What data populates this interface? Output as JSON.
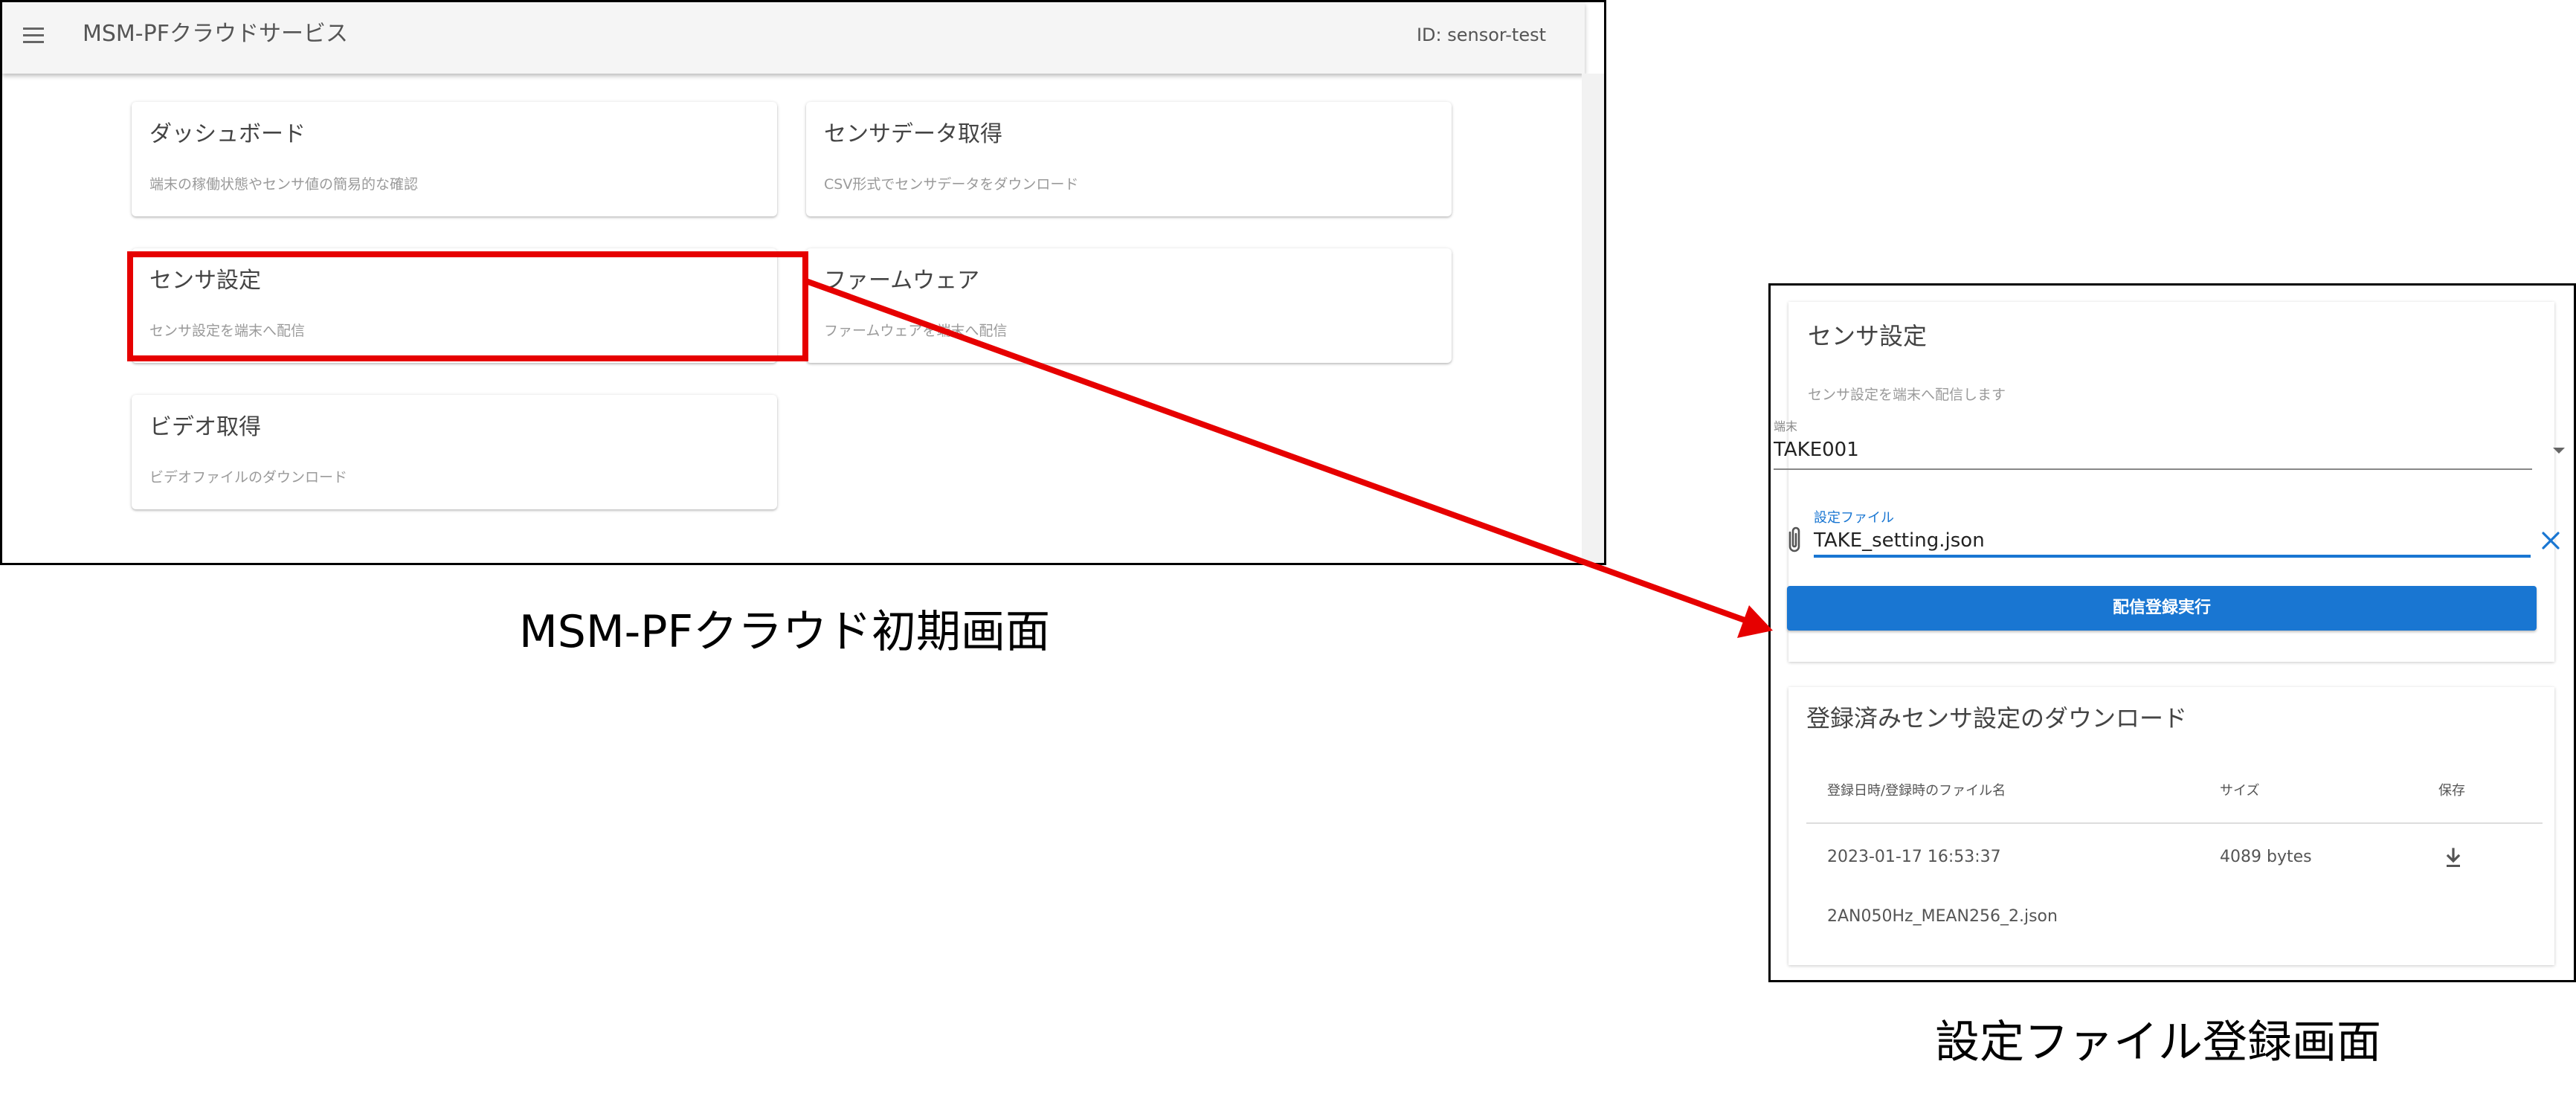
{
  "main_screen": {
    "app_title": "MSM-PFクラウドサービス",
    "user_id": "ID: sensor-test",
    "cards": [
      {
        "title": "ダッシュボード",
        "description": "端末の稼働状態やセンサ値の簡易的な確認"
      },
      {
        "title": "センサデータ取得",
        "description": "CSV形式でセンサデータをダウンロード"
      },
      {
        "title": "センサ設定",
        "description": "センサ設定を端末へ配信"
      },
      {
        "title": "ファームウェア",
        "description": "ファームウェアを端末へ配信"
      },
      {
        "title": "ビデオ取得",
        "description": "ビデオファイルのダウンロード"
      }
    ],
    "highlight_color": "#e60000",
    "caption": "MSM-PFクラウド初期画面"
  },
  "settings_screen": {
    "title": "センサ設定",
    "description": "センサ設定を端末へ配信します",
    "device": {
      "label": "端末",
      "value": "TAKE001"
    },
    "file": {
      "label": "設定ファイル",
      "value": "TAKE_setting.json"
    },
    "submit_label": "配信登録実行",
    "download": {
      "title": "登録済みセンサ設定のダウンロード",
      "columns": [
        "登録日時/登録時のファイル名",
        "サイズ",
        "保存"
      ],
      "rows": [
        {
          "datetime": "2023-01-17 16:53:37",
          "size": "4089 bytes",
          "filename": "2AN050Hz_MEAN256_2.json"
        }
      ]
    },
    "caption": "設定ファイル登録画面"
  },
  "colors": {
    "primary": "#1976d2",
    "annotation": "#e60000"
  },
  "icons": [
    "menu-icon",
    "dropdown-icon",
    "paperclip-icon",
    "clear-icon",
    "download-icon"
  ]
}
